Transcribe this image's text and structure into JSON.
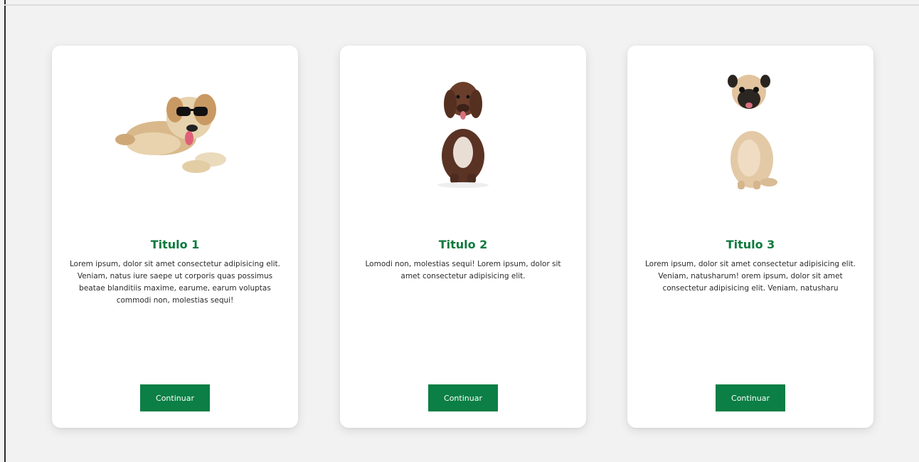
{
  "cards": [
    {
      "image_icon": "dog-with-sunglasses",
      "title": "Titulo 1",
      "text": "Lorem ipsum, dolor sit amet consectetur adipisicing elit. Veniam, natus iure saepe ut corporis quas possimus beatae blanditiis maxime, earume, earum voluptas commodi non, molestias sequi!",
      "button_label": "Continuar"
    },
    {
      "image_icon": "brown-curly-dog",
      "title": "Titulo 2",
      "text": "Lomodi non, molestias sequi! Lorem ipsum, dolor sit amet consectetur adipisicing elit.",
      "button_label": "Continuar"
    },
    {
      "image_icon": "pug-dog",
      "title": "Titulo 3",
      "text": "Lorem ipsum, dolor sit amet consectetur adipisicing elit. Veniam, natusharum! orem ipsum, dolor sit amet consectetur adipisicing elit. Veniam, natusharu",
      "button_label": "Continuar"
    }
  ],
  "colors": {
    "accent": "#0b7f45",
    "title": "#0b7a3e",
    "background": "#f2f2f2",
    "card": "#ffffff"
  }
}
